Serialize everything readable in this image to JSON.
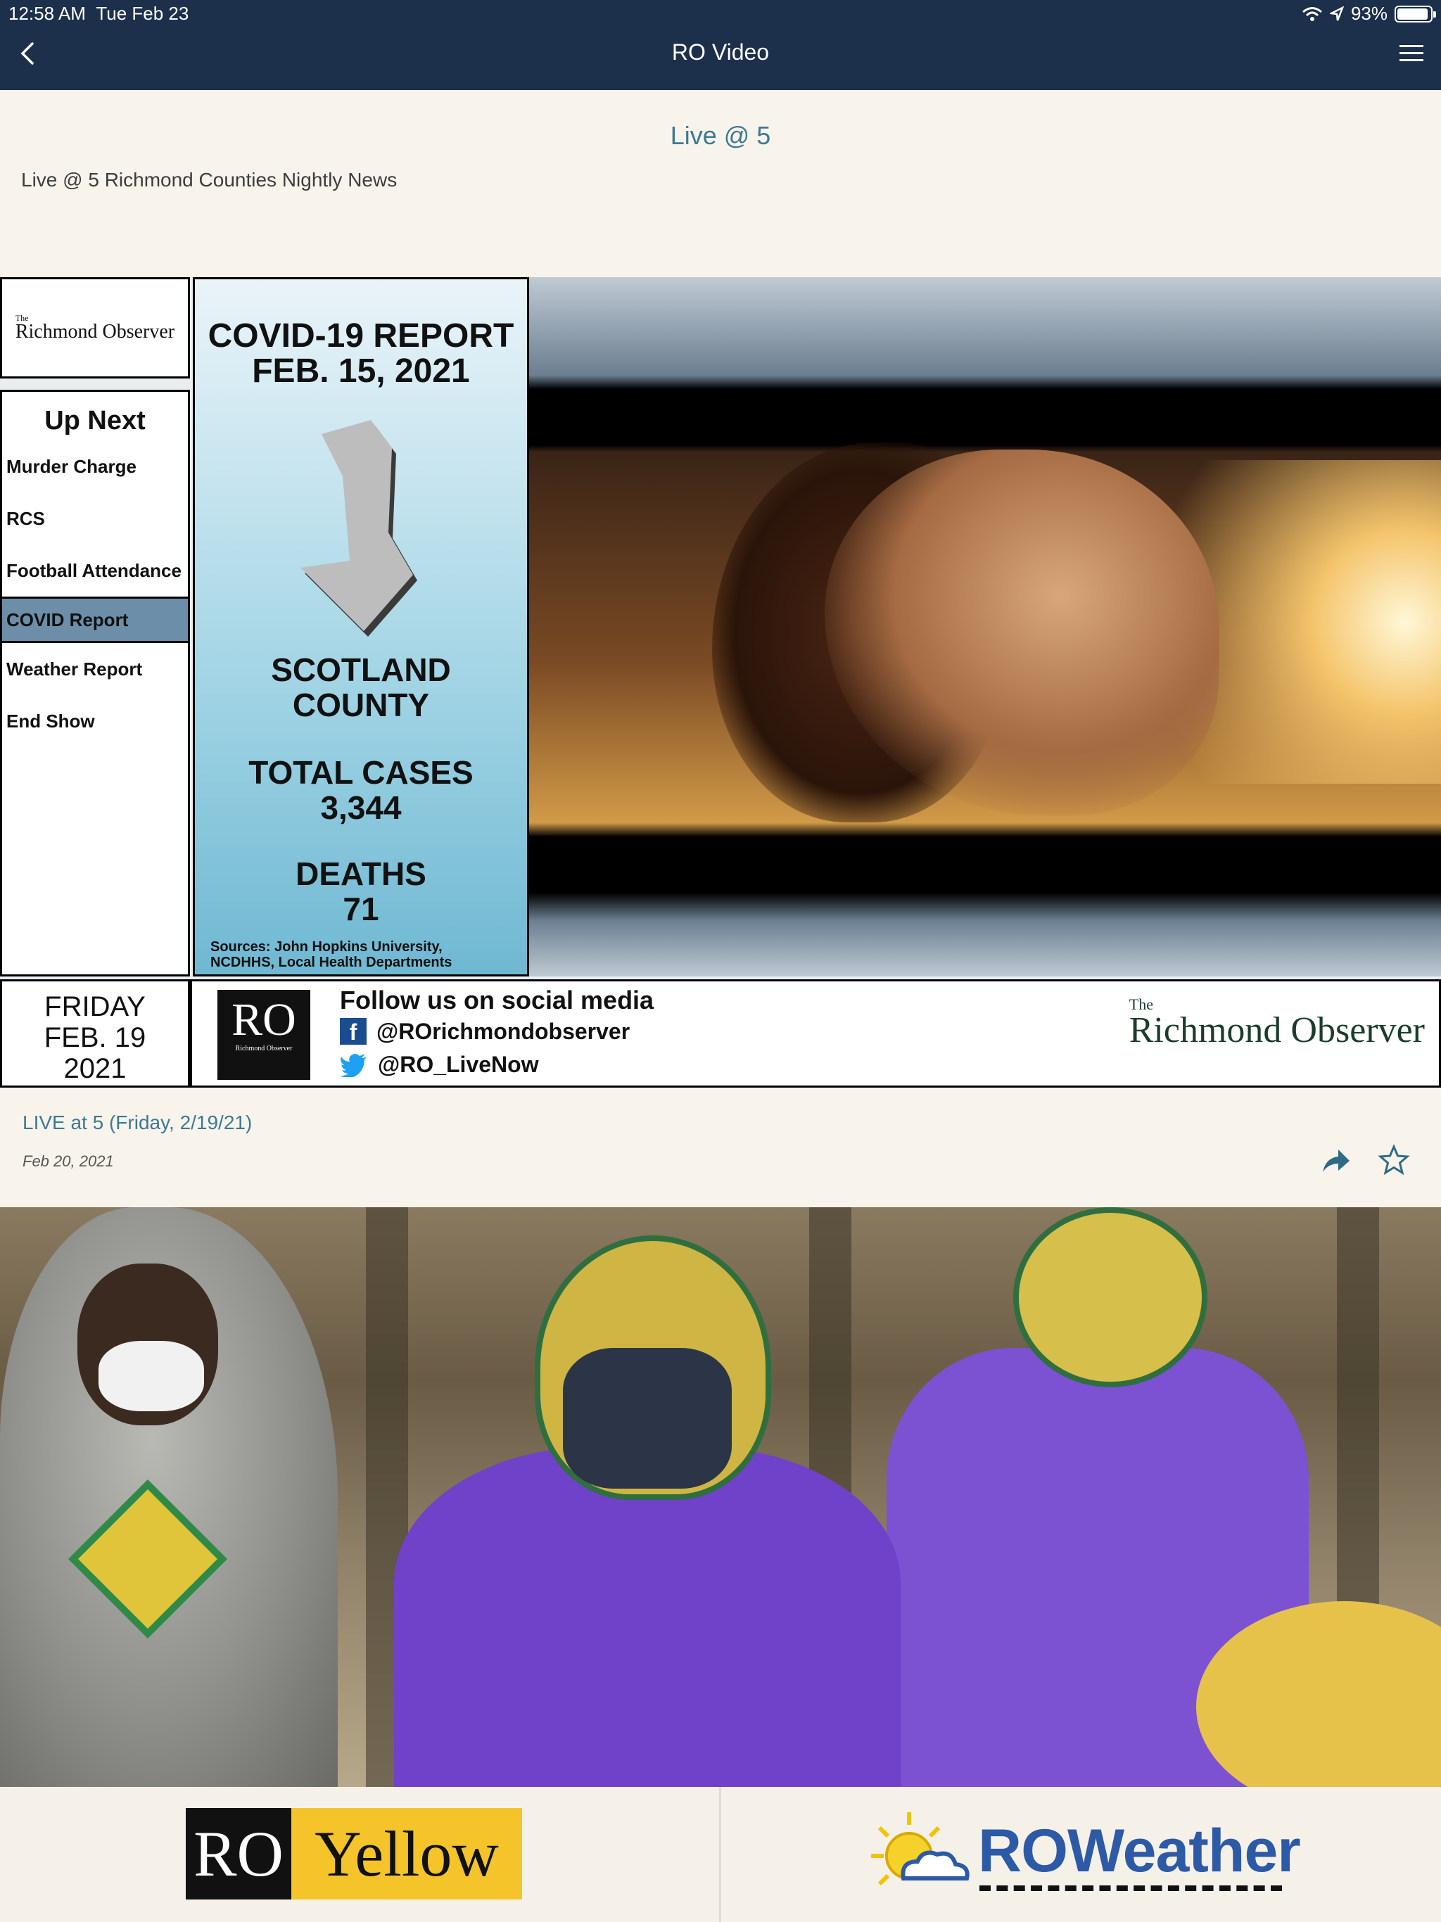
{
  "status_bar": {
    "time": "12:58 AM",
    "date": "Tue Feb 23",
    "battery": "93%",
    "battery_level": 0.93
  },
  "nav": {
    "title": "RO Video"
  },
  "show": {
    "title": "Live @ 5",
    "description": "Live @ 5 Richmond Counties Nightly News"
  },
  "video1": {
    "logo_the": "The",
    "logo_name": "Richmond Observer",
    "up_next": {
      "heading": "Up Next",
      "items": [
        "Murder Charge",
        "RCS",
        "Football Attendance",
        "COVID Report",
        "Weather Report",
        "End Show"
      ],
      "active_index": 3
    },
    "covid": {
      "title_line1": "COVID-19 REPORT",
      "title_line2": "FEB. 15, 2021",
      "county_line1": "SCOTLAND",
      "county_line2": "COUNTY",
      "cases_label": "TOTAL CASES",
      "cases_value": "3,344",
      "deaths_label": "DEATHS",
      "deaths_value": "71",
      "sources_line1": "Sources: John Hopkins University,",
      "sources_line2": "NCDHHS, Local Health Departments"
    },
    "date": {
      "day": "FRIDAY",
      "date": "FEB. 19",
      "year": "2021"
    },
    "social": {
      "ro_mark": "RO",
      "ro_mark_sub": "Richmond Observer",
      "heading": "Follow us on social media",
      "facebook": "@ROrichmondobserver",
      "twitter": "@RO_LiveNow",
      "brand_the": "The",
      "brand_name": "Richmond Observer"
    }
  },
  "item": {
    "title": "LIVE at 5 (Friday, 2/19/21)",
    "date": "Feb 20, 2021"
  },
  "ads": {
    "left": {
      "ro": "RO",
      "word": "Yellow"
    },
    "right": {
      "text": "ROWeather"
    }
  },
  "colors": {
    "nav_bg": "#1c2f4b",
    "accent": "#3c7a93",
    "page_bg": "#f8f4ec"
  }
}
